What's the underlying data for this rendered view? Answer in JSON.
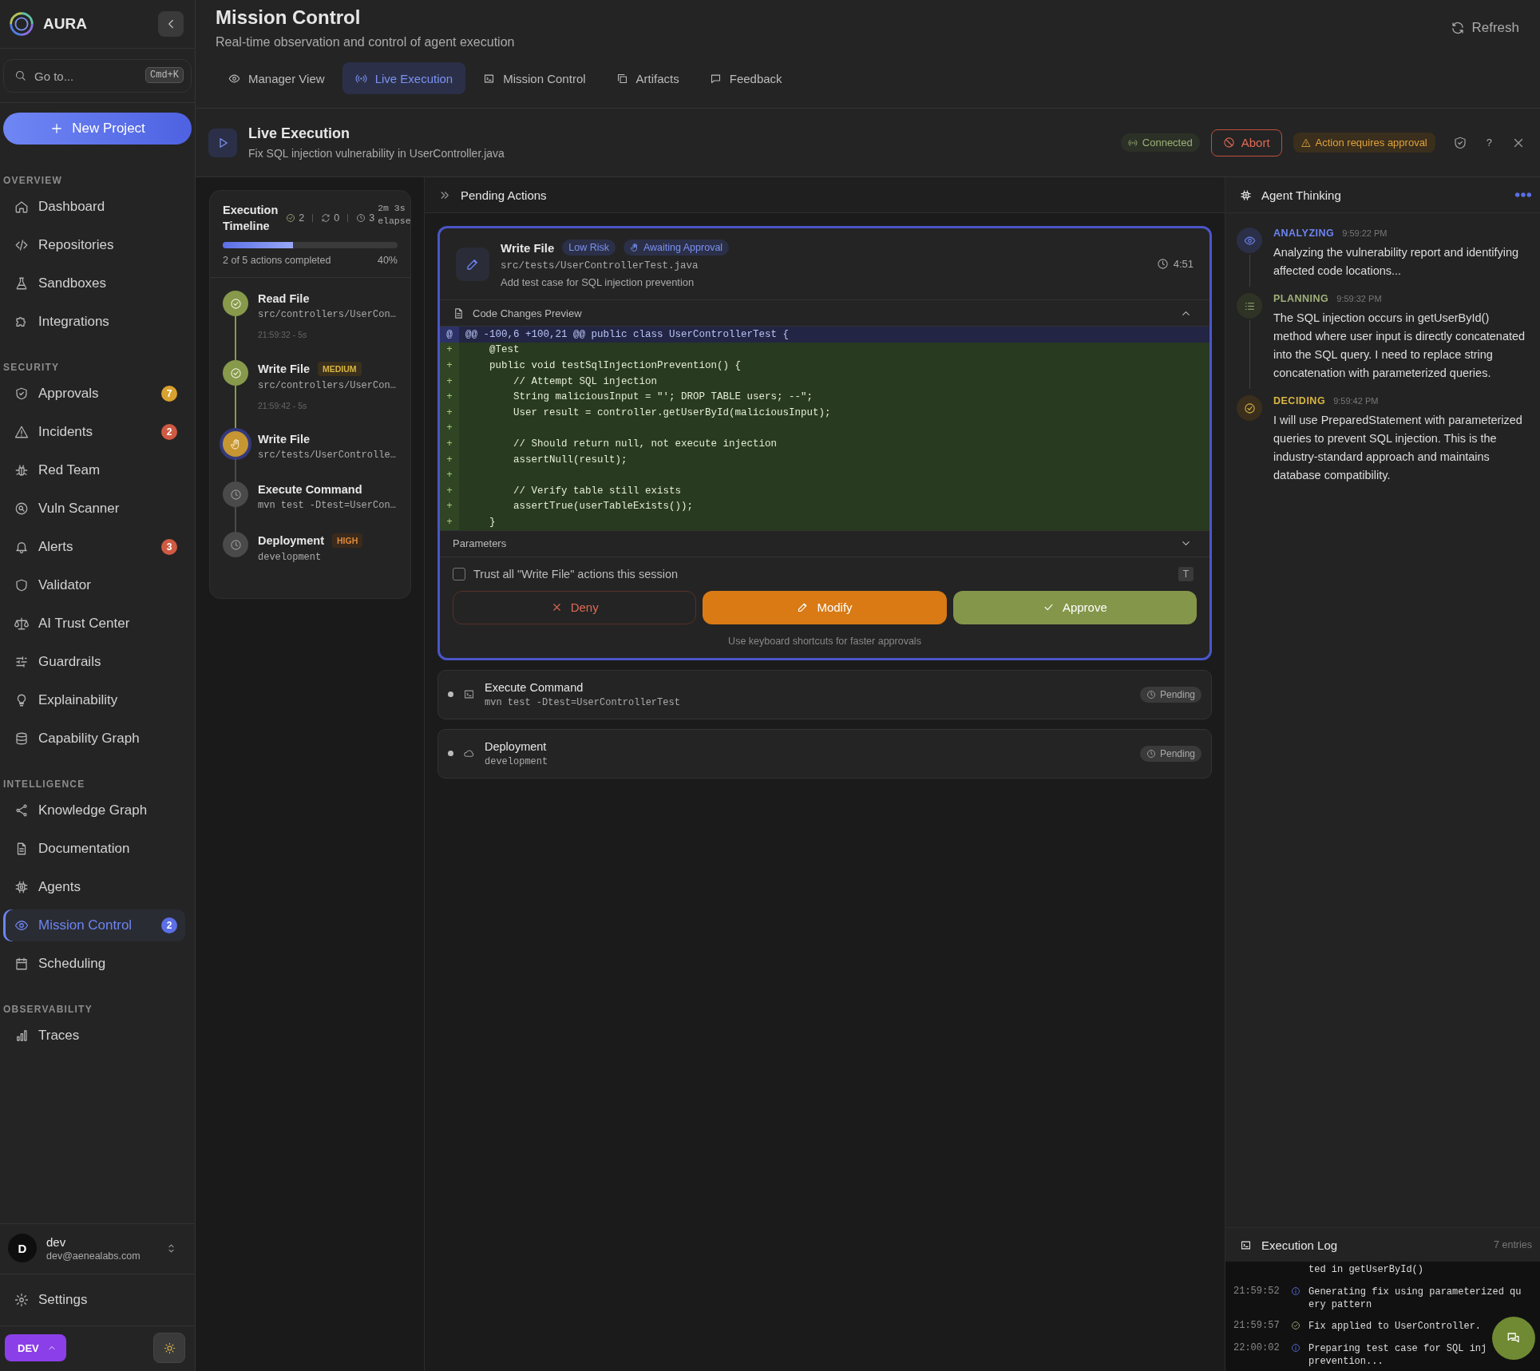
{
  "sidebar": {
    "brand": "AURA",
    "search": {
      "placeholder": "Go to...",
      "shortcut": "Cmd+K"
    },
    "new_project": "New Project",
    "sections": [
      {
        "title": "OVERVIEW",
        "items": [
          {
            "label": "Dashboard",
            "selected": false
          },
          {
            "label": "Repositories",
            "selected": false
          },
          {
            "label": "Sandboxes",
            "selected": false
          },
          {
            "label": "Integrations",
            "selected": false
          }
        ]
      },
      {
        "title": "SECURITY",
        "items": [
          {
            "label": "Approvals",
            "selected": false,
            "badge": "7",
            "color": "#d9a12e"
          },
          {
            "label": "Incidents",
            "selected": false,
            "badge": "2",
            "color": "#cf5a43"
          },
          {
            "label": "Red Team",
            "selected": false
          },
          {
            "label": "Vuln Scanner",
            "selected": false
          },
          {
            "label": "Alerts",
            "selected": false,
            "badge": "3",
            "color": "#cf5a43"
          },
          {
            "label": "Validator",
            "selected": false
          },
          {
            "label": "AI Trust Center",
            "selected": false
          },
          {
            "label": "Guardrails",
            "selected": false
          },
          {
            "label": "Explainability",
            "selected": false
          },
          {
            "label": "Capability Graph",
            "selected": false
          }
        ]
      },
      {
        "title": "INTELLIGENCE",
        "items": [
          {
            "label": "Knowledge Graph",
            "selected": false
          },
          {
            "label": "Documentation",
            "selected": false
          },
          {
            "label": "Agents",
            "selected": false
          },
          {
            "label": "Mission Control",
            "selected": true,
            "badge": "2",
            "color": "#5b6fe6"
          },
          {
            "label": "Scheduling",
            "selected": false
          }
        ]
      },
      {
        "title": "OBSERVABILITY",
        "items": [
          {
            "label": "Traces",
            "selected": false
          }
        ]
      }
    ],
    "user": {
      "initial": "D",
      "name": "dev",
      "email": "dev@aenealabs.com"
    },
    "settings": "Settings",
    "env_badge": "DEV"
  },
  "header": {
    "title": "Mission Control",
    "subtitle": "Real-time observation and control of agent execution",
    "refresh": "Refresh",
    "tabs": [
      {
        "label": "Manager View",
        "selected": false
      },
      {
        "label": "Live Execution",
        "selected": true
      },
      {
        "label": "Mission Control",
        "selected": false
      },
      {
        "label": "Artifacts",
        "selected": false
      },
      {
        "label": "Feedback",
        "selected": false
      }
    ]
  },
  "execution": {
    "title": "Live Execution",
    "subtitle": "Fix SQL injection vulnerability in UserController.java",
    "connection": "Connected",
    "abort": "Abort",
    "alert": "Action requires approval",
    "help": "?"
  },
  "timeline": {
    "title": "Execution Timeline",
    "done_count": "2",
    "loop_count": "0",
    "clock_count": "3",
    "elapsed": "2m 3s elapse",
    "level": 0.4,
    "progress_text": "2 of 5 actions completed",
    "percent": "40%",
    "steps": [
      {
        "title": "Read File",
        "kind": "done",
        "detail": "src/controllers/UserCon…",
        "time": "21:59:32 - 5s"
      },
      {
        "title": "Write File",
        "kind": "done",
        "detail": "src/controllers/UserCon…",
        "time": "21:59:42 - 5s",
        "risk": {
          "label": "MEDIUM",
          "kind": "medium"
        }
      },
      {
        "title": "Write File",
        "kind": "awaiting",
        "detail": "src/tests/UserControlle…"
      },
      {
        "title": "Execute Command",
        "kind": "pending",
        "detail": "mvn test -Dtest=UserCon…"
      },
      {
        "title": "Deployment",
        "kind": "pending",
        "detail": "development",
        "risk": {
          "label": "HIGH",
          "kind": "high"
        }
      }
    ]
  },
  "pending": {
    "title": "Pending Actions",
    "active": {
      "title": "Write File",
      "risk": "Low Risk",
      "status": "Awaiting Approval",
      "path": "src/tests/UserControllerTest.java",
      "description": "Add test case for SQL injection prevention",
      "timer": "4:51",
      "preview_title": "Code Changes Preview",
      "preview_expanded": true,
      "diff": [
        {
          "kind": "hunk",
          "sign": "@",
          "text": "@@ -100,6 +100,21 @@ public class UserControllerTest {"
        },
        {
          "kind": "add",
          "sign": "+",
          "text": "    @Test"
        },
        {
          "kind": "add",
          "sign": "+",
          "text": "    public void testSqlInjectionPrevention() {"
        },
        {
          "kind": "add",
          "sign": "+",
          "text": "        // Attempt SQL injection"
        },
        {
          "kind": "add",
          "sign": "+",
          "text": "        String maliciousInput = \"'; DROP TABLE users; --\";"
        },
        {
          "kind": "add",
          "sign": "+",
          "text": "        User result = controller.getUserById(maliciousInput);"
        },
        {
          "kind": "add",
          "sign": "+"
        },
        {
          "kind": "add",
          "sign": "+",
          "text": "        // Should return null, not execute injection"
        },
        {
          "kind": "add",
          "sign": "+",
          "text": "        assertNull(result);"
        },
        {
          "kind": "add",
          "sign": "+"
        },
        {
          "kind": "add",
          "sign": "+",
          "text": "        // Verify table still exists"
        },
        {
          "kind": "add",
          "sign": "+",
          "text": "        assertTrue(userTableExists());"
        },
        {
          "kind": "add",
          "sign": "+",
          "text": "    }"
        }
      ],
      "parameters_title": "Parameters",
      "parameters_expanded": false,
      "trust": {
        "label": "Trust all \"Write File\" actions this session",
        "checked": false,
        "shortcut": "T"
      },
      "buttons": [
        {
          "label": "Deny",
          "kind": "deny"
        },
        {
          "label": "Modify",
          "kind": "modify"
        },
        {
          "label": "Approve",
          "kind": "approve"
        }
      ],
      "hint": "Use keyboard shortcuts for faster approvals"
    },
    "queued": [
      {
        "title": "Execute Command",
        "detail": "mvn test -Dtest=UserControllerTest",
        "status": "Pending"
      },
      {
        "title": "Deployment",
        "detail": "development",
        "status": "Pending"
      }
    ]
  },
  "thinking": {
    "title": "Agent Thinking",
    "entries": [
      {
        "kind": "analyzing",
        "label": "ANALYZING",
        "time": "9:59:22 PM",
        "text": "Analyzing the vulnerability report and identifying affected code locations..."
      },
      {
        "kind": "planning",
        "label": "PLANNING",
        "time": "9:59:32 PM",
        "text": "The SQL injection occurs in getUserById() method where user input is directly concatenated into the SQL query. I need to replace string concatenation with parameterized queries."
      },
      {
        "kind": "deciding",
        "label": "DECIDING",
        "time": "9:59:42 PM",
        "text": "I will use PreparedStatement with parameterized queries to prevent SQL injection. This is the industry-standard approach and maintains database compatibility."
      }
    ]
  },
  "log": {
    "title": "Execution Log",
    "count": "7 entries",
    "entries": [
      {
        "lines": [
          "ted in getUserById()"
        ]
      },
      {
        "time": "21:59:52",
        "kind": "info",
        "lines": [
          "Generating fix using parameterized qu",
          "ery pattern"
        ]
      },
      {
        "time": "21:59:57",
        "kind": "success",
        "lines": [
          "Fix applied to UserController."
        ]
      },
      {
        "time": "22:00:02",
        "kind": "info",
        "lines": [
          "Preparing test case for SQL inj",
          "prevention..."
        ]
      }
    ]
  }
}
